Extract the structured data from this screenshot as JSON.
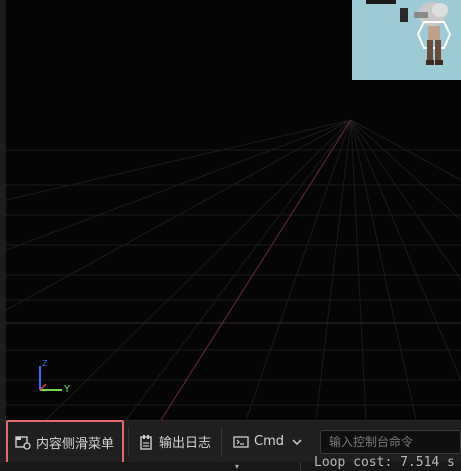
{
  "viewport": {
    "axis_y_label": "Y",
    "axis_z_label": "Z"
  },
  "bottom_bar": {
    "content_drawer_label": "内容侧滑菜单",
    "output_log_label": "输出日志",
    "cmd_label": "Cmd",
    "console_placeholder": "输入控制台命令"
  },
  "status": {
    "loop_cost": "Loop cost: 7.514 s"
  },
  "colors": {
    "highlight_border": "#e36a6a",
    "axis_green": "#6fdc4d",
    "axis_blue": "#3b6cff",
    "grid_red_line": "#6b2a2a"
  },
  "icons": {
    "content_drawer": "content-drawer-icon",
    "output_log": "output-log-icon",
    "cmd": "terminal-icon",
    "dropdown": "chevron-down-icon"
  }
}
